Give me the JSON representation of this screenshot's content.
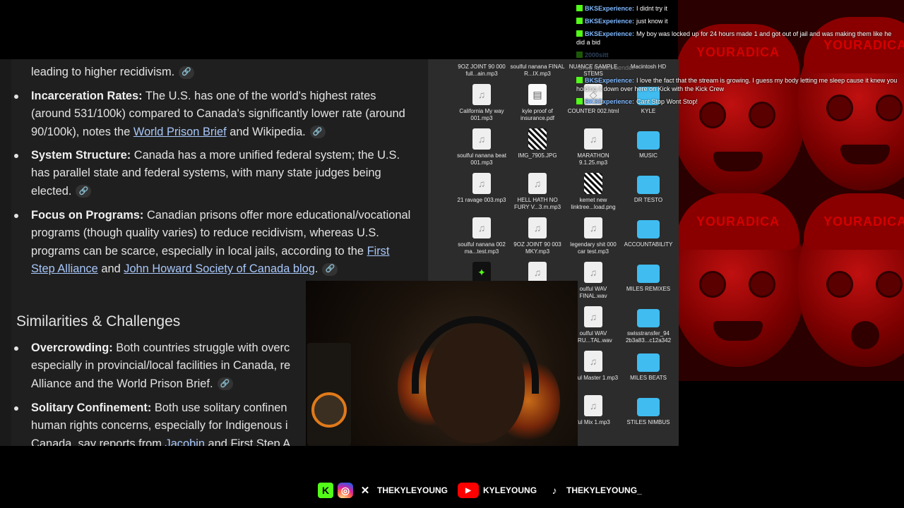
{
  "chat": {
    "messages": [
      {
        "user": "BKSExperience:",
        "text": "I didnt try it"
      },
      {
        "user": "BKSExperience:",
        "text": "just know it"
      },
      {
        "user": "BKSExperience:",
        "text": "My boy was locked up for 24 hours made 1 and got out of jail and was making them like he did a bid"
      },
      {
        "user": "2000sitt",
        "text": ""
      },
      {
        "user": "",
        "text": "Drug fuelled bender"
      },
      {
        "user": "BKSExperience:",
        "text": "I love the fact that the stream is growing. I guess my body letting me sleep cause it knew you holding it down over here on Kick with the Kick Crew"
      },
      {
        "user": "BKSExperience:",
        "text": "Cant Stop Wont Stop!"
      }
    ]
  },
  "browser": {
    "line_top": "leading to higher recidivism.",
    "incarceration": {
      "label": "Incarceration Rates:",
      "text": " The U.S. has one of the world's highest rates (around 531/100k) compared to Canada's significantly lower rate (around 90/100k), notes the ",
      "link1": "World Prison Brief",
      "mid": " and Wikipedia."
    },
    "system": {
      "label": "System Structure:",
      "text": " Canada has a more unified federal system; the U.S. has parallel state and federal systems, with many state judges being elected."
    },
    "programs": {
      "label": "Focus on Programs:",
      "text": " Canadian prisons offer more educational/vocational programs (though quality varies) to reduce recidivism, whereas U.S. programs can be scarce, especially in local jails, according to the ",
      "link1": "First Step Alliance",
      "and": " and ",
      "link2": "John Howard Society of Canada blog",
      "end": "."
    },
    "heading": "Similarities & Challenges",
    "overcrowding": {
      "label": "Overcrowding:",
      "text": " Both countries struggle with overc",
      "line2": "especially in provincial/local facilities in Canada, re",
      "line3": "Alliance and the World Prison Brief."
    },
    "solitary": {
      "label": "Solitary Confinement:",
      "text": " Both use solitary confinen",
      "line2": "human rights concerns, especially for Indigenous i",
      "line3_a": "Canada, say reports from ",
      "line3_link": "Jacobin",
      "line3_b": " and First Step A"
    },
    "link_chip": "🔗"
  },
  "desktop": {
    "files": [
      {
        "name": "9OZ JOINT 90 000 full...ain.mp3",
        "type": "audio"
      },
      {
        "name": "soulful nanana FINAL R...IX.mp3",
        "type": "audio"
      },
      {
        "name": "NUANCE SAMPLE STEMS",
        "type": "folder"
      },
      {
        "name": "Macintosh HD",
        "type": "disk"
      },
      {
        "name": "California My way 001.mp3",
        "type": "audio"
      },
      {
        "name": "kyle proof of insurance.pdf",
        "type": "pdf"
      },
      {
        "name": "COUNTER 002.html",
        "type": "html"
      },
      {
        "name": "KYLE",
        "type": "folder"
      },
      {
        "name": "soulful nanana beat 001.mp3",
        "type": "audio"
      },
      {
        "name": "IMG_7905.JPG",
        "type": "qr"
      },
      {
        "name": "MARATHON 9.1.25.mp3",
        "type": "audio"
      },
      {
        "name": "MUSIC",
        "type": "folder"
      },
      {
        "name": "21 ravage 003.mp3",
        "type": "audio"
      },
      {
        "name": "HELL HATH NO FURY V...3.m.mp3",
        "type": "audio"
      },
      {
        "name": "kemet new linktree...load.png",
        "type": "qr"
      },
      {
        "name": "DR TESTO",
        "type": "folder"
      },
      {
        "name": "soulful nanana 002 ma...test.mp3",
        "type": "audio"
      },
      {
        "name": "9OZ JOINT 90 003 MKY.mp3",
        "type": "audio"
      },
      {
        "name": "legendary shit 000 car test.mp3",
        "type": "audio"
      },
      {
        "name": "ACCOUNTABILITY",
        "type": "folder"
      },
      {
        "name": "",
        "type": "app"
      },
      {
        "name": "",
        "type": "audio"
      },
      {
        "name": "oulful WAV FINAL.wav",
        "type": "audio"
      },
      {
        "name": "MILES REMIXES",
        "type": "folder"
      },
      {
        "name": "oulful WAV TRU...TAL.wav",
        "type": "audio"
      },
      {
        "name": "swisstransfer_94 2b3a83...c12a342",
        "type": "folder"
      },
      {
        "name": "oulful Master 1.mp3",
        "type": "audio"
      },
      {
        "name": "MILES BEATS",
        "type": "folder"
      },
      {
        "name": "ful Mix 1.mp3",
        "type": "audio"
      },
      {
        "name": "STILES NIMBUS",
        "type": "folder"
      }
    ]
  },
  "background": {
    "cap_text": "YOURADICA"
  },
  "footer": {
    "kick_handle": "THEKYLEYOUNG",
    "x_handle": "THEKYLEYOUNG",
    "youtube_handle": "KYLEYOUNG",
    "tiktok_handle": "THEKYLEYOUNG_"
  }
}
